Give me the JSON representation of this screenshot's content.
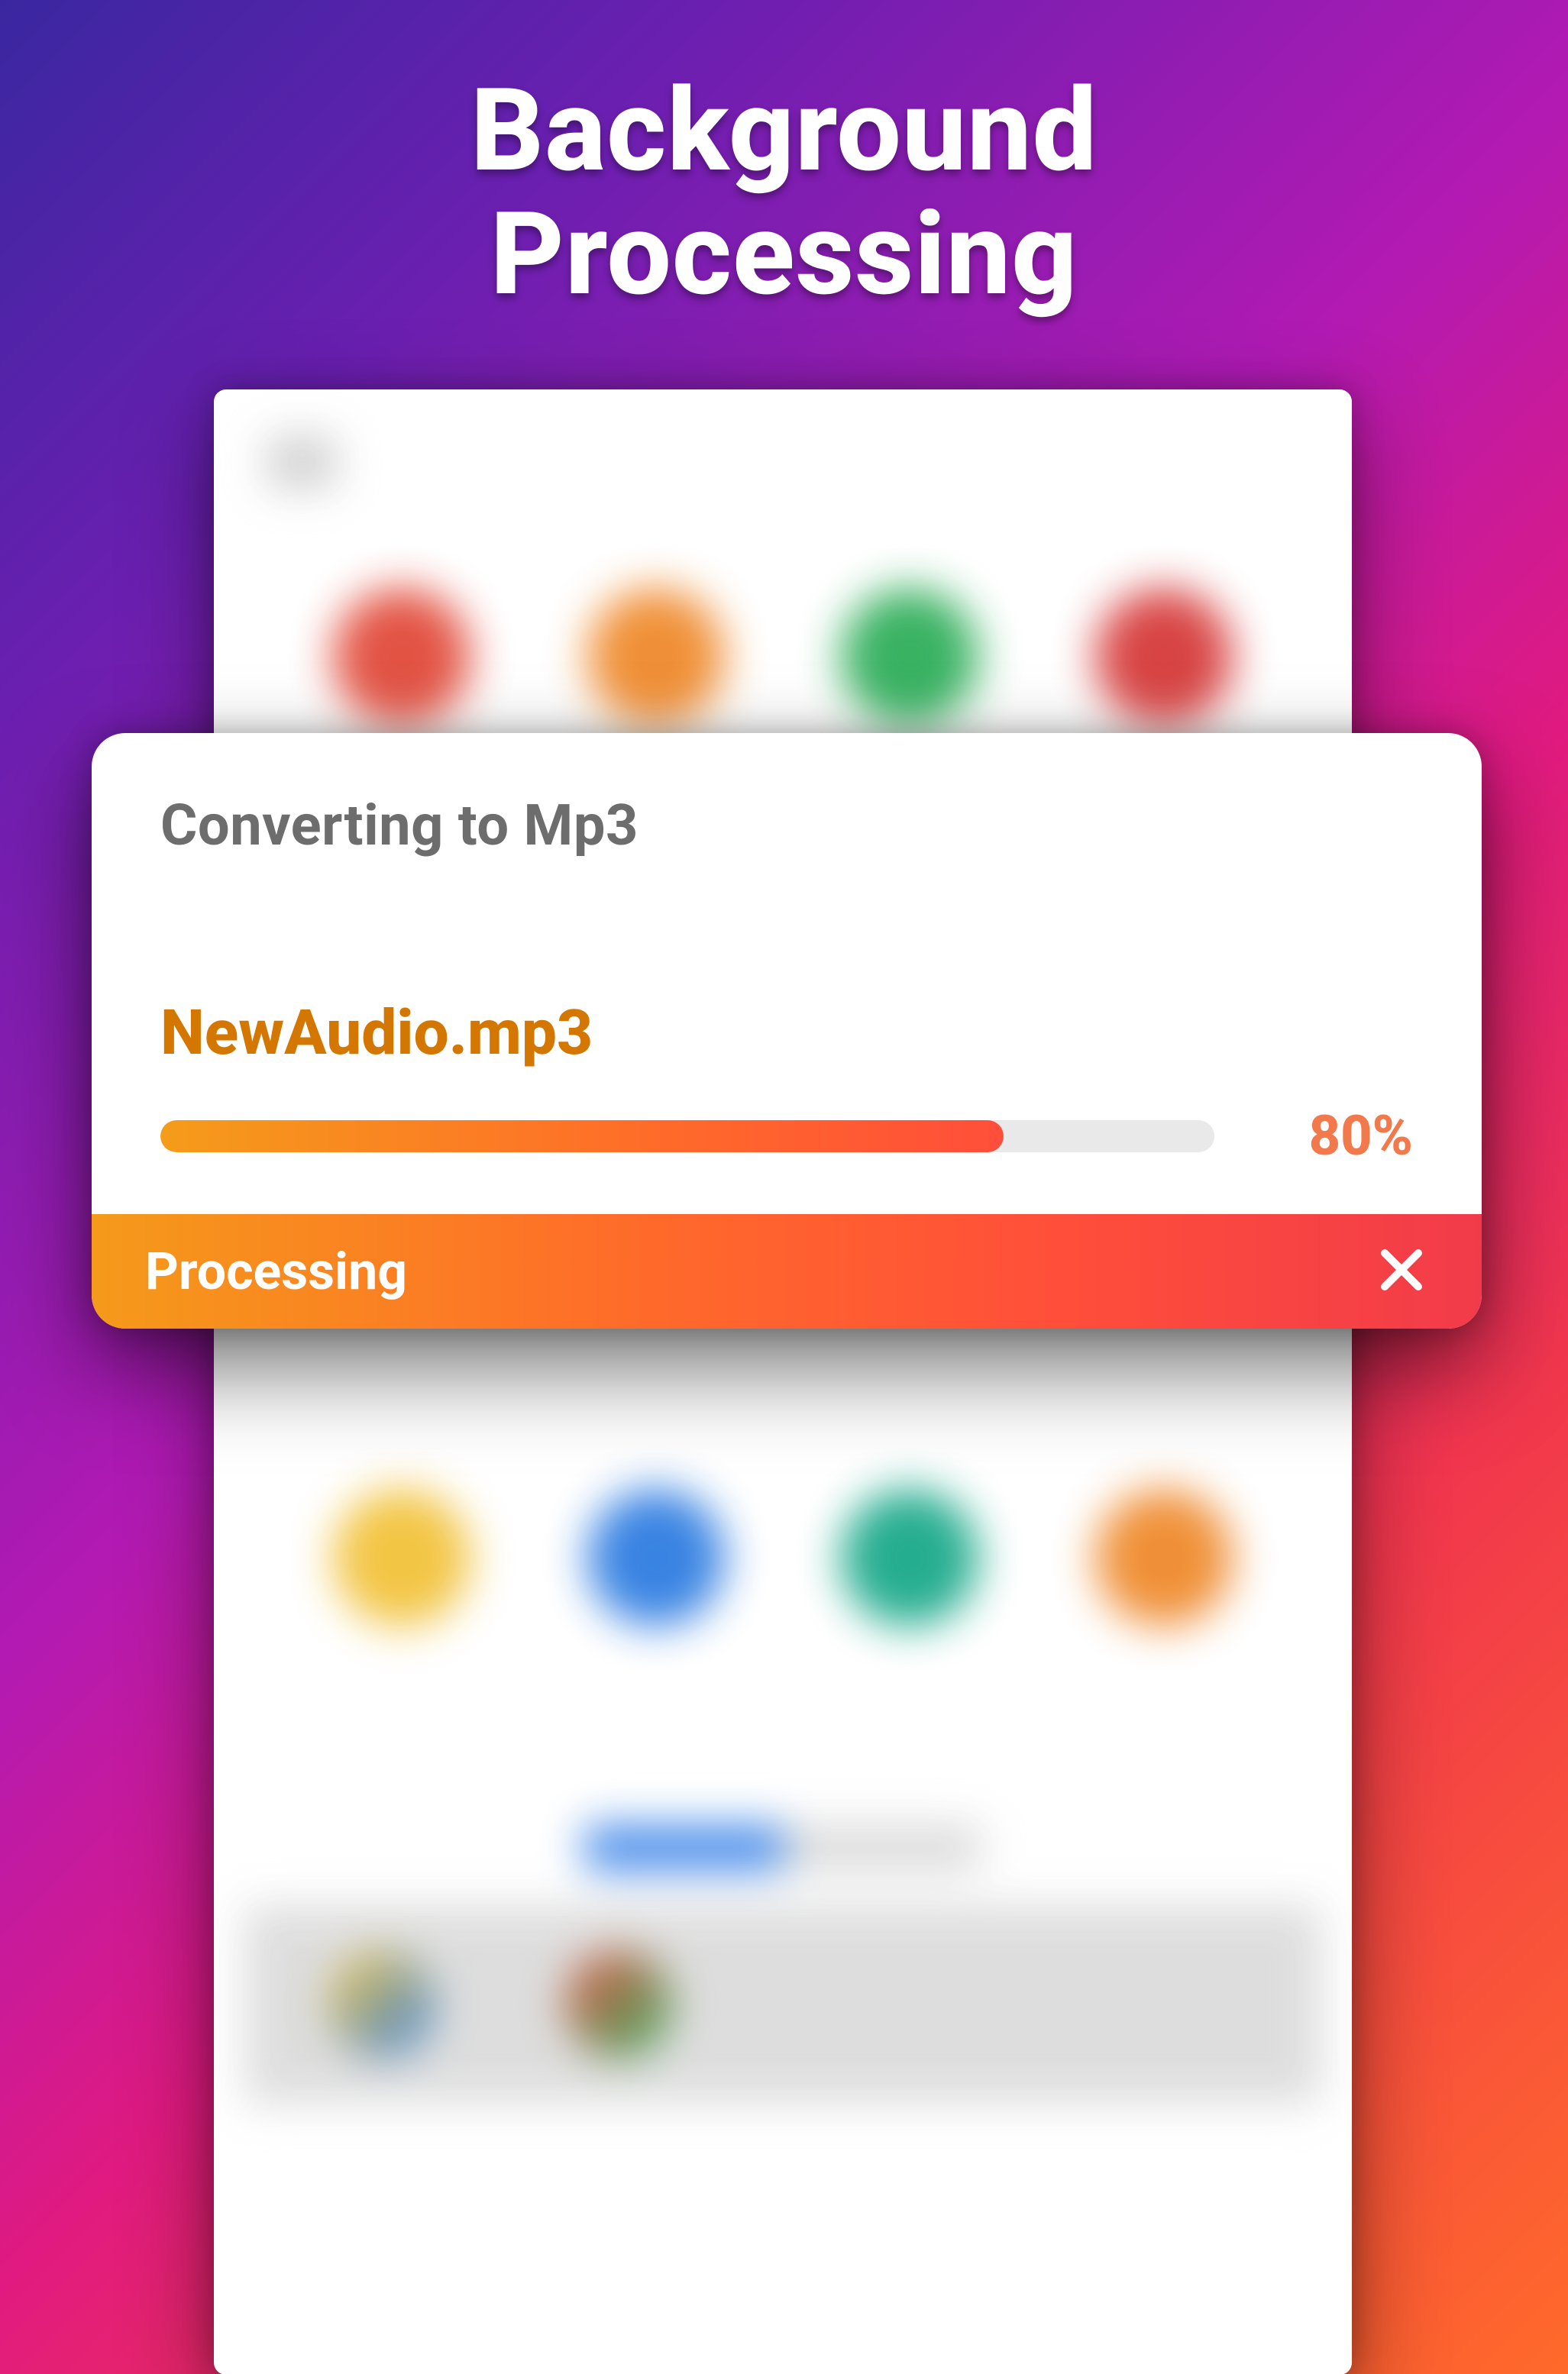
{
  "promo": {
    "title_line1": "Background",
    "title_line2": "Processing"
  },
  "dialog": {
    "title": "Converting to Mp3",
    "file_name": "NewAudio.mp3",
    "progress_percent_label": "80%",
    "progress_percent_value": 80,
    "footer_label": "Processing",
    "close_icon": "close-icon"
  },
  "colors": {
    "accent_orange": "#ff6a2a",
    "accent_red": "#f23b4a",
    "filename_color": "#d37700",
    "title_gray": "#6d6d6d"
  }
}
